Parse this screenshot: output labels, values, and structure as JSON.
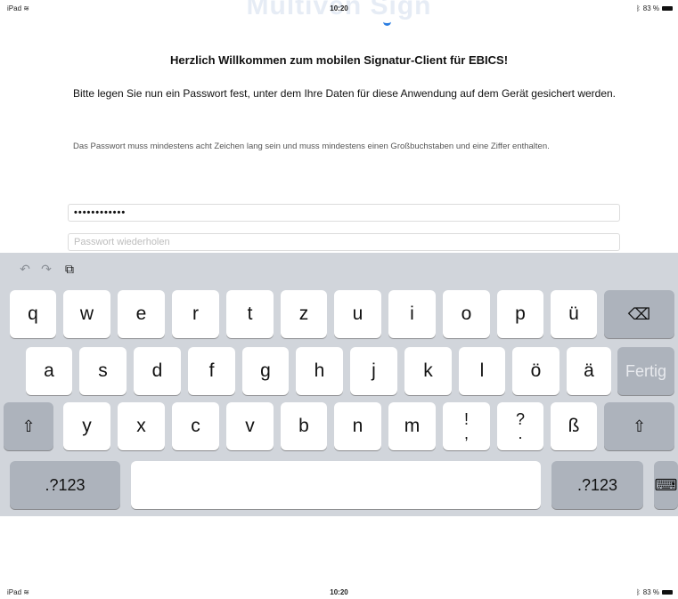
{
  "status_bar": {
    "device": "iPad",
    "time": "10:20",
    "battery": "83 %"
  },
  "brand": {
    "ghost_text": "Multiven Sign"
  },
  "content": {
    "title": "Herzlich Willkommen zum mobilen Signatur-Client für EBICS!",
    "lead": "Bitte legen Sie nun ein Passwort fest, unter dem Ihre Daten für diese Anwendung auf dem Gerät gesichert werden.",
    "hint": "Das Passwort muss mindestens acht Zeichen lang sein und muss mindestens einen Großbuchstaben und eine Ziffer enthalten.",
    "password_value": "••••••••••••",
    "repeat_placeholder": "Passwort wiederholen"
  },
  "keyboard": {
    "toolbar": {
      "undo": "↶",
      "redo": "↷",
      "paste": "⧉"
    },
    "row1": [
      "q",
      "w",
      "e",
      "r",
      "t",
      "z",
      "u",
      "i",
      "o",
      "p",
      "ü"
    ],
    "row2": [
      "a",
      "s",
      "d",
      "f",
      "g",
      "h",
      "j",
      "k",
      "l",
      "ö",
      "ä"
    ],
    "row3": [
      "y",
      "x",
      "c",
      "v",
      "b",
      "n",
      "m"
    ],
    "punct1": {
      "top": "!",
      "bottom": ","
    },
    "punct2": {
      "top": "?",
      "bottom": "."
    },
    "eszett": "ß",
    "backspace": "⌫",
    "done": "Fertig",
    "shift": "⇧",
    "numbers": ".?123",
    "hide": "⌨"
  },
  "bottom_status": {
    "device": "iPad",
    "time": "10:20",
    "battery": "83 %"
  }
}
